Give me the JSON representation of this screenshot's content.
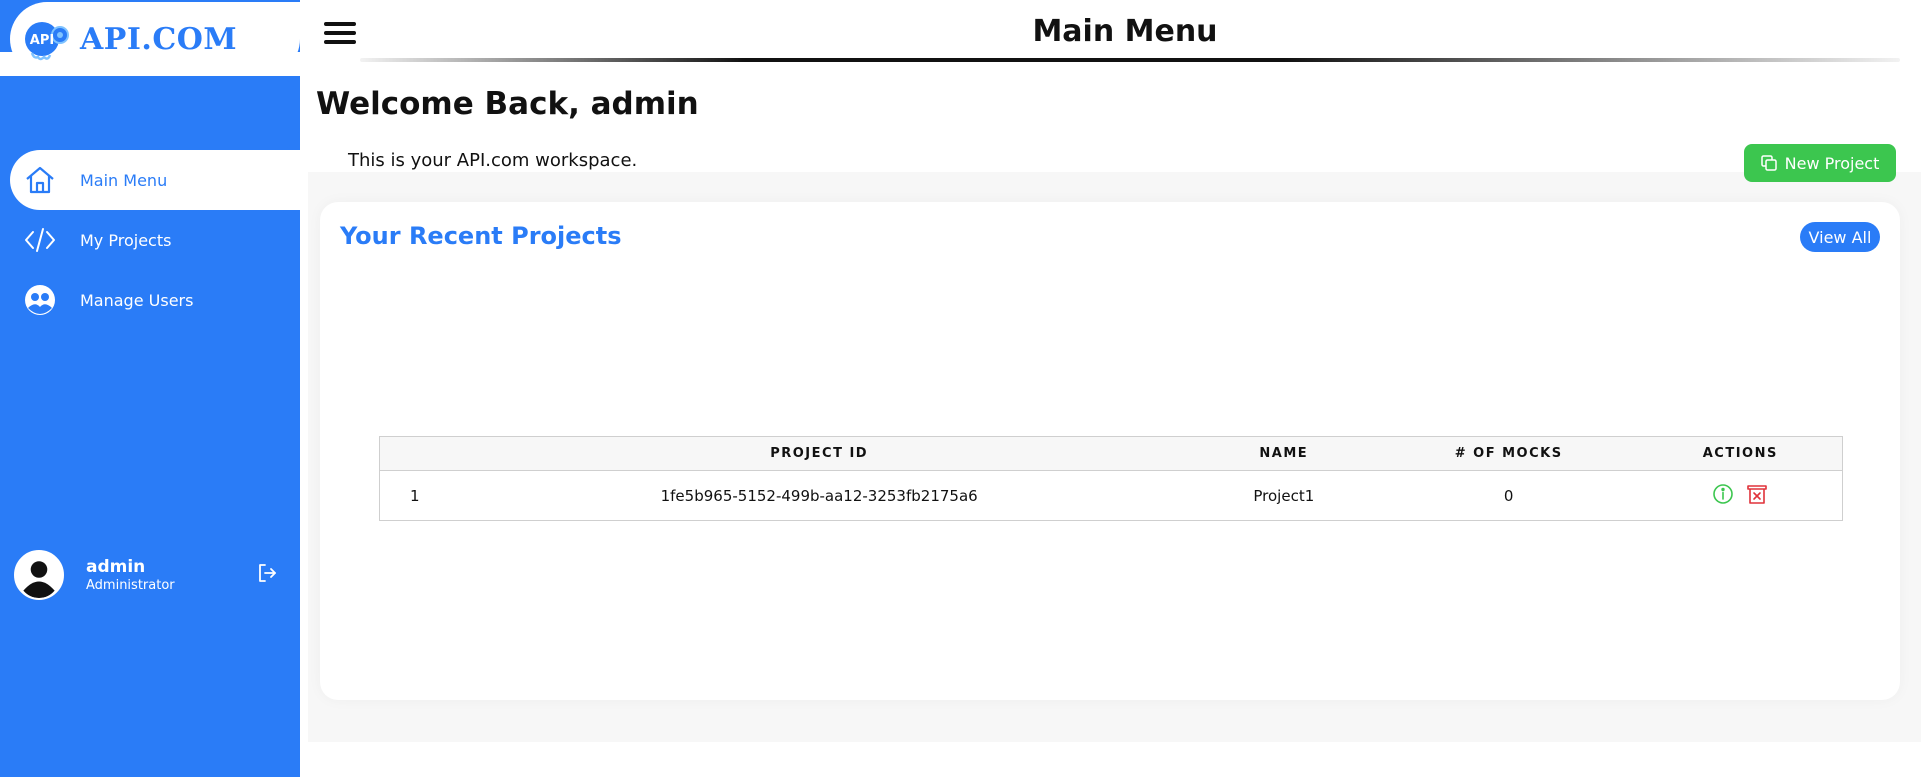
{
  "brand": {
    "logo_badge_text": "API",
    "logo_text": "API.COM"
  },
  "header": {
    "title": "Main Menu"
  },
  "sidebar": {
    "items": [
      {
        "label": "Main Menu",
        "icon": "home-icon",
        "active": true
      },
      {
        "label": "My Projects",
        "icon": "code-icon",
        "active": false
      },
      {
        "label": "Manage Users",
        "icon": "users-icon",
        "active": false
      }
    ],
    "user": {
      "name": "admin",
      "role": "Administrator"
    }
  },
  "main": {
    "welcome": "Welcome Back, admin",
    "description": "This is your API.com workspace.",
    "new_project_label": "New Project",
    "recent_title": "Your Recent Projects",
    "view_all_label": "View All",
    "table": {
      "columns": [
        "",
        "PROJECT ID",
        "NAME",
        "# OF MOCKS",
        "ACTIONS"
      ],
      "rows": [
        {
          "index": "1",
          "project_id": "1fe5b965-5152-499b-aa12-3253fb2175a6",
          "name": "Project1",
          "mocks": "0"
        }
      ]
    }
  },
  "colors": {
    "primary": "#2a7cf7",
    "success": "#3cc64f",
    "danger": "#e0323a"
  }
}
